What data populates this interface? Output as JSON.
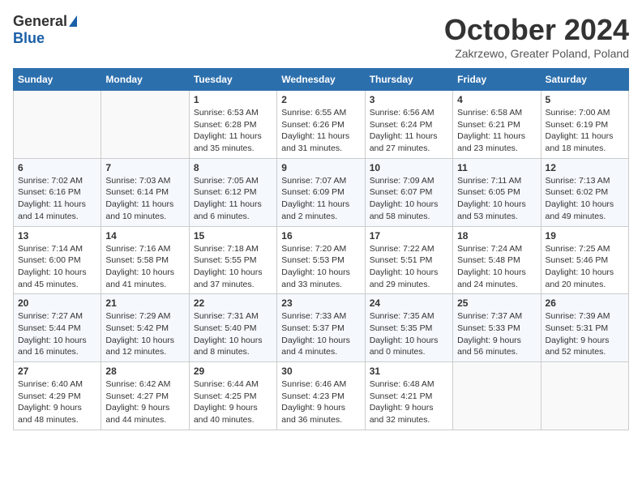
{
  "logo": {
    "general": "General",
    "blue": "Blue"
  },
  "title": "October 2024",
  "location": "Zakrzewo, Greater Poland, Poland",
  "headers": [
    "Sunday",
    "Monday",
    "Tuesday",
    "Wednesday",
    "Thursday",
    "Friday",
    "Saturday"
  ],
  "rows": [
    [
      {
        "day": "",
        "text": ""
      },
      {
        "day": "",
        "text": ""
      },
      {
        "day": "1",
        "text": "Sunrise: 6:53 AM\nSunset: 6:28 PM\nDaylight: 11 hours and 35 minutes."
      },
      {
        "day": "2",
        "text": "Sunrise: 6:55 AM\nSunset: 6:26 PM\nDaylight: 11 hours and 31 minutes."
      },
      {
        "day": "3",
        "text": "Sunrise: 6:56 AM\nSunset: 6:24 PM\nDaylight: 11 hours and 27 minutes."
      },
      {
        "day": "4",
        "text": "Sunrise: 6:58 AM\nSunset: 6:21 PM\nDaylight: 11 hours and 23 minutes."
      },
      {
        "day": "5",
        "text": "Sunrise: 7:00 AM\nSunset: 6:19 PM\nDaylight: 11 hours and 18 minutes."
      }
    ],
    [
      {
        "day": "6",
        "text": "Sunrise: 7:02 AM\nSunset: 6:16 PM\nDaylight: 11 hours and 14 minutes."
      },
      {
        "day": "7",
        "text": "Sunrise: 7:03 AM\nSunset: 6:14 PM\nDaylight: 11 hours and 10 minutes."
      },
      {
        "day": "8",
        "text": "Sunrise: 7:05 AM\nSunset: 6:12 PM\nDaylight: 11 hours and 6 minutes."
      },
      {
        "day": "9",
        "text": "Sunrise: 7:07 AM\nSunset: 6:09 PM\nDaylight: 11 hours and 2 minutes."
      },
      {
        "day": "10",
        "text": "Sunrise: 7:09 AM\nSunset: 6:07 PM\nDaylight: 10 hours and 58 minutes."
      },
      {
        "day": "11",
        "text": "Sunrise: 7:11 AM\nSunset: 6:05 PM\nDaylight: 10 hours and 53 minutes."
      },
      {
        "day": "12",
        "text": "Sunrise: 7:13 AM\nSunset: 6:02 PM\nDaylight: 10 hours and 49 minutes."
      }
    ],
    [
      {
        "day": "13",
        "text": "Sunrise: 7:14 AM\nSunset: 6:00 PM\nDaylight: 10 hours and 45 minutes."
      },
      {
        "day": "14",
        "text": "Sunrise: 7:16 AM\nSunset: 5:58 PM\nDaylight: 10 hours and 41 minutes."
      },
      {
        "day": "15",
        "text": "Sunrise: 7:18 AM\nSunset: 5:55 PM\nDaylight: 10 hours and 37 minutes."
      },
      {
        "day": "16",
        "text": "Sunrise: 7:20 AM\nSunset: 5:53 PM\nDaylight: 10 hours and 33 minutes."
      },
      {
        "day": "17",
        "text": "Sunrise: 7:22 AM\nSunset: 5:51 PM\nDaylight: 10 hours and 29 minutes."
      },
      {
        "day": "18",
        "text": "Sunrise: 7:24 AM\nSunset: 5:48 PM\nDaylight: 10 hours and 24 minutes."
      },
      {
        "day": "19",
        "text": "Sunrise: 7:25 AM\nSunset: 5:46 PM\nDaylight: 10 hours and 20 minutes."
      }
    ],
    [
      {
        "day": "20",
        "text": "Sunrise: 7:27 AM\nSunset: 5:44 PM\nDaylight: 10 hours and 16 minutes."
      },
      {
        "day": "21",
        "text": "Sunrise: 7:29 AM\nSunset: 5:42 PM\nDaylight: 10 hours and 12 minutes."
      },
      {
        "day": "22",
        "text": "Sunrise: 7:31 AM\nSunset: 5:40 PM\nDaylight: 10 hours and 8 minutes."
      },
      {
        "day": "23",
        "text": "Sunrise: 7:33 AM\nSunset: 5:37 PM\nDaylight: 10 hours and 4 minutes."
      },
      {
        "day": "24",
        "text": "Sunrise: 7:35 AM\nSunset: 5:35 PM\nDaylight: 10 hours and 0 minutes."
      },
      {
        "day": "25",
        "text": "Sunrise: 7:37 AM\nSunset: 5:33 PM\nDaylight: 9 hours and 56 minutes."
      },
      {
        "day": "26",
        "text": "Sunrise: 7:39 AM\nSunset: 5:31 PM\nDaylight: 9 hours and 52 minutes."
      }
    ],
    [
      {
        "day": "27",
        "text": "Sunrise: 6:40 AM\nSunset: 4:29 PM\nDaylight: 9 hours and 48 minutes."
      },
      {
        "day": "28",
        "text": "Sunrise: 6:42 AM\nSunset: 4:27 PM\nDaylight: 9 hours and 44 minutes."
      },
      {
        "day": "29",
        "text": "Sunrise: 6:44 AM\nSunset: 4:25 PM\nDaylight: 9 hours and 40 minutes."
      },
      {
        "day": "30",
        "text": "Sunrise: 6:46 AM\nSunset: 4:23 PM\nDaylight: 9 hours and 36 minutes."
      },
      {
        "day": "31",
        "text": "Sunrise: 6:48 AM\nSunset: 4:21 PM\nDaylight: 9 hours and 32 minutes."
      },
      {
        "day": "",
        "text": ""
      },
      {
        "day": "",
        "text": ""
      }
    ]
  ]
}
